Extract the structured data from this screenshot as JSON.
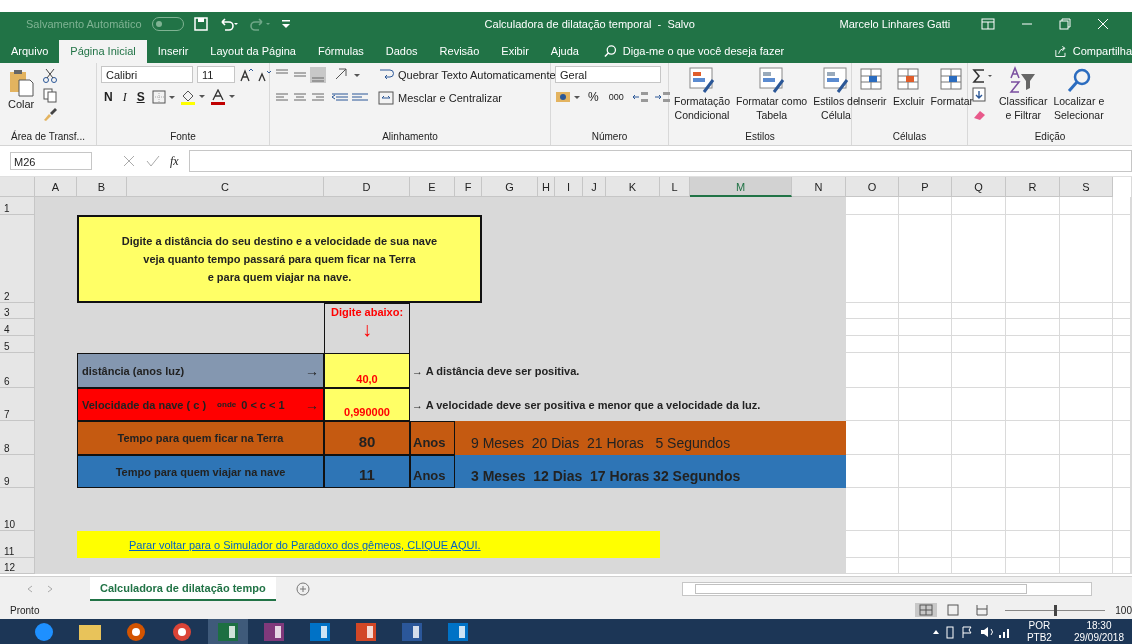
{
  "title_bar": {
    "autosave_label": "Salvamento Automático",
    "autosave_on": false,
    "title": "Calculadora de dilatação temporal  -  Salvo",
    "user": "Marcelo Linhares Gatti"
  },
  "menu_tabs": [
    {
      "label": "Arquivo",
      "selected": false
    },
    {
      "label": "Página Inicial",
      "selected": true
    },
    {
      "label": "Inserir",
      "selected": false
    },
    {
      "label": "Layout da Página",
      "selected": false
    },
    {
      "label": "Fórmulas",
      "selected": false
    },
    {
      "label": "Dados",
      "selected": false
    },
    {
      "label": "Revisão",
      "selected": false
    },
    {
      "label": "Exibir",
      "selected": false
    },
    {
      "label": "Ajuda",
      "selected": false
    }
  ],
  "tell_me": "Diga-me o que você deseja fazer",
  "share": "Compartilha",
  "ribbon": {
    "clipboard": {
      "paste": "Colar",
      "label": "Área de Transf..."
    },
    "font": {
      "name": "Calibri",
      "size": "11",
      "bold": "N",
      "italic": "I",
      "underline": "S",
      "label": "Fonte"
    },
    "alignment": {
      "wrap": "Quebrar Texto Automaticamente",
      "merge": "Mesclar e Centralizar",
      "label": "Alinhamento"
    },
    "number": {
      "format": "Geral",
      "percent": "%",
      "thousands": "000",
      "label": "Número"
    },
    "styles": {
      "items": [
        [
          "Formatação",
          "Condicional"
        ],
        [
          "Formatar como",
          "Tabela"
        ],
        [
          "Estilos de",
          "Célula"
        ]
      ],
      "label": "Estilos"
    },
    "cells": {
      "items": [
        "Inserir",
        "Excluir",
        "Formatar"
      ],
      "label": "Células"
    },
    "editing": {
      "items": [
        [
          "Classificar",
          "e Filtrar"
        ],
        [
          "Localizar e",
          "Selecionar"
        ]
      ],
      "label": "Edição"
    }
  },
  "formula_bar": {
    "name_box": "M26",
    "function_label": "fx"
  },
  "columns": [
    {
      "label": "A",
      "selected": false
    },
    {
      "label": "B",
      "selected": false
    },
    {
      "label": "C",
      "selected": false
    },
    {
      "label": "D",
      "selected": false
    },
    {
      "label": "E",
      "selected": false
    },
    {
      "label": "F",
      "selected": false
    },
    {
      "label": "G",
      "selected": false
    },
    {
      "label": "H",
      "selected": false
    },
    {
      "label": "I",
      "selected": false
    },
    {
      "label": "J",
      "selected": false
    },
    {
      "label": "K",
      "selected": false
    },
    {
      "label": "L",
      "selected": false
    },
    {
      "label": "M",
      "selected": true
    },
    {
      "label": "N",
      "selected": false
    },
    {
      "label": "O",
      "selected": false
    },
    {
      "label": "P",
      "selected": false
    },
    {
      "label": "Q",
      "selected": false
    },
    {
      "label": "R",
      "selected": false
    },
    {
      "label": "S",
      "selected": false
    }
  ],
  "rows": [
    "1",
    "2",
    "3",
    "4",
    "5",
    "6",
    "7",
    "8",
    "9",
    "10",
    "11",
    "12"
  ],
  "sheet": {
    "instructions": [
      "Digite a distância do seu destino e a velocidade de sua nave",
      "veja quanto tempo passará para quem ficar na Terra",
      "e para quem viajar na nave."
    ],
    "input_header": "Digite abaixo:",
    "input_arrow": "↓",
    "inputs": [
      {
        "label": "distância (anos luz)",
        "arrow": "→",
        "value": "40,0",
        "hint": "→  A distância deve ser positiva.",
        "color": "#8497b0"
      },
      {
        "label": "Velocidade da nave ( c )",
        "note": "onde",
        "condition": "0 < c < 1",
        "arrow": "→",
        "value": "0,990000",
        "hint": "→ A velocidade deve ser positiva e menor que a velocidade da luz.",
        "color": "#ff0000"
      }
    ],
    "results": [
      {
        "label": "Tempo para quem ficar na Terra",
        "years": "80",
        "unit": "Anos",
        "detail": "9 Meses  20 Dias  21 Horas   5 Segundos",
        "detail_bold": false,
        "color": "#c55a11"
      },
      {
        "label": "Tempo para quem viajar na nave",
        "years": "11",
        "unit": "Anos",
        "detail": "3 Meses  12 Dias  17 Horas 32 Segundos",
        "detail_bold": true,
        "color": "#2e75b6"
      }
    ],
    "link": "Parar voltar para o Simulador do Paradoxo dos gêmeos, CLIQUE AQUI."
  },
  "sheet_tabs": [
    {
      "label": "Calculadora de dilatação tempo",
      "selected": true
    }
  ],
  "status": {
    "text": "Pronto",
    "zoom": "100",
    "zoom_slider": {
      "level": 0.5
    }
  },
  "taskbar": {
    "apps": [
      {
        "kind": "browser",
        "selected": false
      },
      {
        "kind": "folder",
        "selected": false
      },
      {
        "kind": "media",
        "selected": false
      },
      {
        "kind": "chrome",
        "selected": false
      },
      {
        "kind": "excel",
        "selected": true
      },
      {
        "kind": "onenote",
        "selected": false
      },
      {
        "kind": "outlook",
        "selected": false
      },
      {
        "kind": "powerpoint",
        "selected": false
      },
      {
        "kind": "word",
        "selected": false
      },
      {
        "kind": "outlook",
        "selected": false
      }
    ],
    "language": "POR",
    "layout": "PTB2",
    "time": "18:30",
    "date": "29/09/2018"
  }
}
